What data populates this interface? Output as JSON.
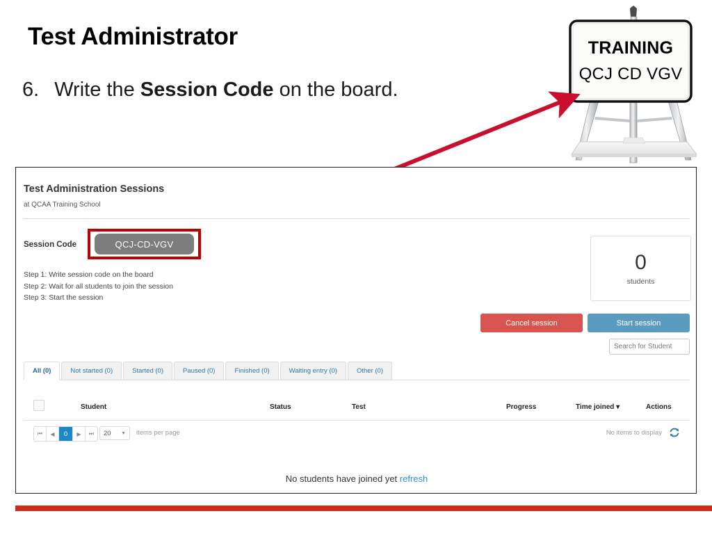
{
  "slide": {
    "title": "Test Administrator",
    "step_number": "6.",
    "step_text_pre": "Write the ",
    "step_text_bold": "Session Code",
    "step_text_post": " on the board."
  },
  "easel": {
    "board_title": "TRAINING",
    "board_code": "QCJ CD VGV",
    "arrow_color": "#c8102e"
  },
  "app": {
    "title": "Test Administration Sessions",
    "subtitle": "at QCAA Training School",
    "session_code_label": "Session Code",
    "session_code_value": "QCJ-CD-VGV",
    "highlight_color": "#c00000",
    "badge_color": "#7d7d7d",
    "steps": [
      "Step 1: Write session code on the board",
      "Step 2: Wait for all students to join the session",
      "Step 3: Start the session"
    ],
    "students_count": "0",
    "students_label": "students",
    "cancel_button": "Cancel session",
    "start_button": "Start session",
    "cancel_color": "#d9534f",
    "start_color": "#5b9bc0",
    "search_placeholder": "Search for Student",
    "search_value": "",
    "tabs": [
      {
        "label": "All (0)",
        "active": true
      },
      {
        "label": "Not started (0)",
        "active": false
      },
      {
        "label": "Started (0)",
        "active": false
      },
      {
        "label": "Paused (0)",
        "active": false
      },
      {
        "label": "Finished (0)",
        "active": false
      },
      {
        "label": "Waiting entry (0)",
        "active": false
      },
      {
        "label": "Other (0)",
        "active": false
      }
    ],
    "table": {
      "columns": [
        "Student",
        "Status",
        "Test",
        "Progress",
        "Time joined ▾",
        "Actions"
      ],
      "rows": [],
      "no_items_text": "No items to display"
    },
    "pager": {
      "first": "⏮",
      "prev": "◀",
      "current_page": "0",
      "next": "▶",
      "last": "⏭",
      "per_page_value": "20",
      "per_page_caret": "▼",
      "per_page_label": "items per page",
      "refresh_icon": "refresh-icon"
    },
    "empty_message": "No students have joined yet",
    "empty_message_link": "refresh"
  },
  "footer": {
    "bar_color": "#cf2a1b"
  }
}
